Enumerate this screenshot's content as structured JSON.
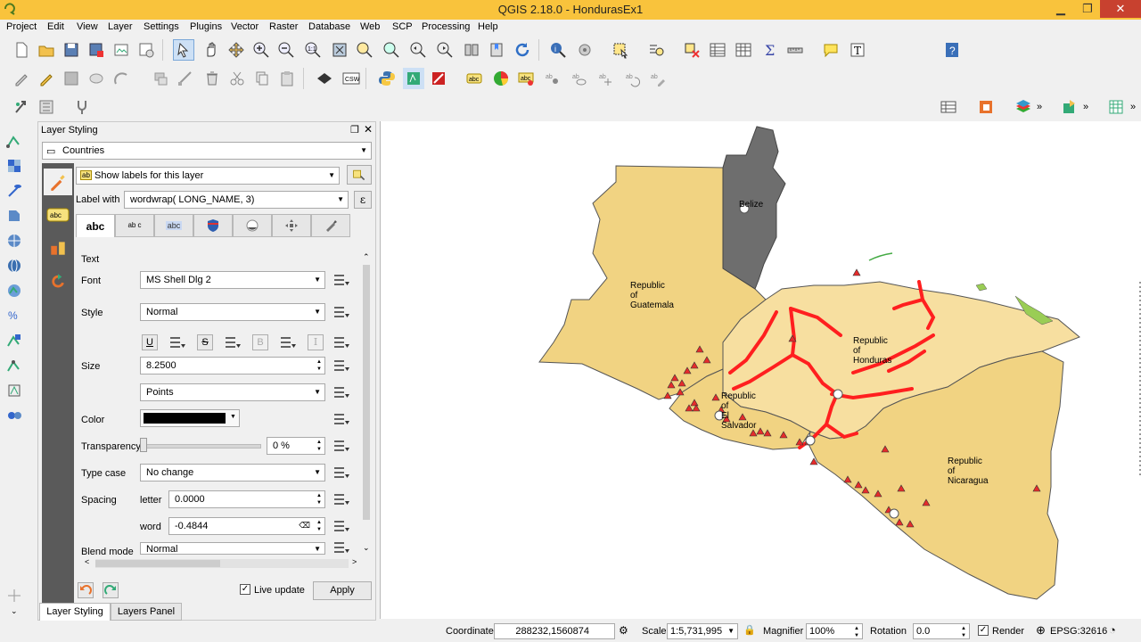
{
  "window": {
    "title": "QGIS 2.18.0 - HondurasEx1"
  },
  "menu": [
    "Project",
    "Edit",
    "View",
    "Layer",
    "Settings",
    "Plugins",
    "Vector",
    "Raster",
    "Database",
    "Web",
    "SCP",
    "Processing",
    "Help"
  ],
  "dock": {
    "title": "Layer Styling",
    "layer_select": "Countries",
    "label_mode": "Show labels for this layer",
    "label_with_caption": "Label with",
    "label_expression": "wordwrap( LONG_NAME, 3)",
    "tabs": [
      "abc",
      "ab c",
      "abc",
      "",
      "",
      "",
      ""
    ],
    "section_title": "Text",
    "font": {
      "label": "Font",
      "value": "MS Shell Dlg 2"
    },
    "style": {
      "label": "Style",
      "value": "Normal"
    },
    "size": {
      "label": "Size",
      "value": "8.2500",
      "unit": "Points"
    },
    "color": {
      "label": "Color",
      "swatch": "#000000"
    },
    "transparency": {
      "label": "Transparency",
      "value": "0 %"
    },
    "type_case": {
      "label": "Type case",
      "value": "No change"
    },
    "spacing": {
      "label": "Spacing",
      "letter_caption": "letter",
      "letter_value": "0.0000",
      "word_caption": "word",
      "word_value": "-0.4844"
    },
    "blend": {
      "label": "Blend mode",
      "value": "Normal"
    },
    "style_buttons": [
      "U",
      "S",
      "B",
      "I"
    ],
    "live_update": "Live update",
    "apply": "Apply"
  },
  "bottom_tabs": [
    "Layer Styling",
    "Layers Panel"
  ],
  "map_labels": {
    "belize": "Belize",
    "guatemala": [
      "Republic",
      "of",
      "Guatemala"
    ],
    "honduras": [
      "Republic",
      "of",
      "Honduras"
    ],
    "el_salvador": [
      "Republic",
      "of",
      "El",
      "Salvador"
    ],
    "nicaragua": [
      "Republic",
      "of",
      "Nicaragua"
    ]
  },
  "status": {
    "coordinate_label": "Coordinate",
    "coordinate": "288232,1560874",
    "scale_label": "Scale",
    "scale": "1:5,731,995",
    "magnifier_label": "Magnifier",
    "magnifier": "100%",
    "rotation_label": "Rotation",
    "rotation": "0.0",
    "render": "Render",
    "crs": "EPSG:32616"
  },
  "colors": {
    "titlebar": "#f9c33c",
    "country_fill": "#f1d382",
    "honduras_fill": "#f7dfa0",
    "belize_fill": "#6e6e6e",
    "road": "#ff1f1f",
    "point": "#e52b2b"
  }
}
